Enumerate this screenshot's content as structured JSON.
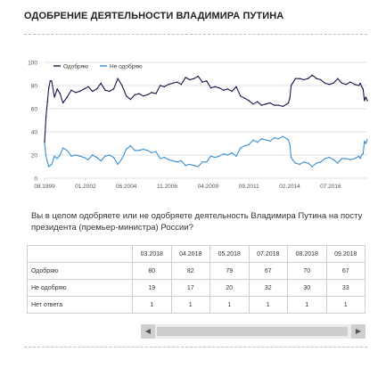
{
  "page": {
    "title": "ОДОБРЕНИЕ ДЕЯТЕЛЬНОСТИ ВЛАДИМИРА ПУТИНА",
    "question": "Вы в целом одобряете или не одобряете деятельность Владимира Путина на посту президента (премьер-министра) России?"
  },
  "colors": {
    "approve": "#1a1446",
    "disapprove": "#3a8fd0",
    "grid": "#d9d9d9",
    "axis_text": "#555555"
  },
  "chart_data": {
    "type": "line",
    "title": "",
    "xlabel": "",
    "ylabel": "",
    "ylim": [
      0,
      100
    ],
    "yticks": [
      "0",
      "20",
      "40",
      "60",
      "80",
      "100"
    ],
    "xlim": [
      "1999-08",
      "2018-09"
    ],
    "xticks": [
      {
        "date": "1999-08",
        "label": "08.1999"
      },
      {
        "date": "2002-01",
        "label": "01.2002"
      },
      {
        "date": "2004-06",
        "label": "06.2004"
      },
      {
        "date": "2006-11",
        "label": "11.2006"
      },
      {
        "date": "2009-04",
        "label": "04.2009"
      },
      {
        "date": "2011-09",
        "label": "09.2011"
      },
      {
        "date": "2014-02",
        "label": "02.2014"
      },
      {
        "date": "2016-07",
        "label": "07.2016"
      }
    ],
    "grid": true,
    "legend_position": "top-left",
    "series": [
      {
        "name": "Одобряю",
        "color_key": "approve",
        "points": [
          [
            "1999-08",
            31
          ],
          [
            "1999-09",
            53
          ],
          [
            "1999-10",
            66
          ],
          [
            "1999-11",
            78
          ],
          [
            "1999-12",
            84
          ],
          [
            "2000-01",
            84
          ],
          [
            "2000-03",
            70
          ],
          [
            "2000-05",
            77
          ],
          [
            "2000-07",
            73
          ],
          [
            "2000-09",
            65
          ],
          [
            "2000-12",
            70
          ],
          [
            "2001-03",
            76
          ],
          [
            "2001-06",
            74
          ],
          [
            "2001-09",
            75
          ],
          [
            "2001-12",
            77
          ],
          [
            "2002-03",
            79
          ],
          [
            "2002-06",
            75
          ],
          [
            "2002-09",
            77
          ],
          [
            "2002-12",
            82
          ],
          [
            "2003-03",
            76
          ],
          [
            "2003-06",
            75
          ],
          [
            "2003-09",
            77
          ],
          [
            "2003-12",
            86
          ],
          [
            "2004-03",
            80
          ],
          [
            "2004-06",
            71
          ],
          [
            "2004-09",
            68
          ],
          [
            "2004-12",
            72
          ],
          [
            "2005-03",
            73
          ],
          [
            "2005-06",
            71
          ],
          [
            "2005-09",
            72
          ],
          [
            "2005-12",
            74
          ],
          [
            "2006-03",
            73
          ],
          [
            "2006-06",
            80
          ],
          [
            "2006-09",
            79
          ],
          [
            "2006-12",
            81
          ],
          [
            "2007-03",
            82
          ],
          [
            "2007-06",
            83
          ],
          [
            "2007-09",
            81
          ],
          [
            "2007-12",
            87
          ],
          [
            "2008-03",
            85
          ],
          [
            "2008-06",
            86
          ],
          [
            "2008-09",
            88
          ],
          [
            "2008-12",
            83
          ],
          [
            "2009-03",
            84
          ],
          [
            "2009-06",
            78
          ],
          [
            "2009-09",
            79
          ],
          [
            "2009-12",
            78
          ],
          [
            "2010-03",
            76
          ],
          [
            "2010-06",
            77
          ],
          [
            "2010-09",
            75
          ],
          [
            "2010-12",
            79
          ],
          [
            "2011-03",
            71
          ],
          [
            "2011-06",
            69
          ],
          [
            "2011-09",
            67
          ],
          [
            "2011-12",
            64
          ],
          [
            "2012-03",
            66
          ],
          [
            "2012-06",
            63
          ],
          [
            "2012-09",
            64
          ],
          [
            "2012-12",
            65
          ],
          [
            "2013-03",
            63
          ],
          [
            "2013-06",
            63
          ],
          [
            "2013-09",
            62
          ],
          [
            "2013-12",
            64
          ],
          [
            "2014-01",
            65
          ],
          [
            "2014-02",
            69
          ],
          [
            "2014-03",
            80
          ],
          [
            "2014-04",
            82
          ],
          [
            "2014-06",
            86
          ],
          [
            "2014-09",
            86
          ],
          [
            "2014-12",
            85
          ],
          [
            "2015-03",
            86
          ],
          [
            "2015-06",
            89
          ],
          [
            "2015-09",
            86
          ],
          [
            "2015-12",
            85
          ],
          [
            "2016-03",
            82
          ],
          [
            "2016-06",
            81
          ],
          [
            "2016-09",
            82
          ],
          [
            "2016-12",
            86
          ],
          [
            "2017-03",
            82
          ],
          [
            "2017-06",
            81
          ],
          [
            "2017-09",
            83
          ],
          [
            "2017-12",
            81
          ],
          [
            "2018-03",
            80
          ],
          [
            "2018-04",
            82
          ],
          [
            "2018-05",
            79
          ],
          [
            "2018-06",
            77
          ],
          [
            "2018-07",
            67
          ],
          [
            "2018-08",
            70
          ],
          [
            "2018-09",
            67
          ]
        ]
      },
      {
        "name": "Не одобряю",
        "color_key": "disapprove",
        "points": [
          [
            "1999-08",
            30
          ],
          [
            "1999-09",
            19
          ],
          [
            "1999-10",
            14
          ],
          [
            "1999-11",
            10
          ],
          [
            "1999-12",
            11
          ],
          [
            "2000-01",
            12
          ],
          [
            "2000-03",
            19
          ],
          [
            "2000-05",
            17
          ],
          [
            "2000-07",
            20
          ],
          [
            "2000-09",
            26
          ],
          [
            "2000-12",
            24
          ],
          [
            "2001-03",
            19
          ],
          [
            "2001-06",
            20
          ],
          [
            "2001-09",
            19
          ],
          [
            "2001-12",
            18
          ],
          [
            "2002-03",
            16
          ],
          [
            "2002-06",
            20
          ],
          [
            "2002-09",
            18
          ],
          [
            "2002-12",
            15
          ],
          [
            "2003-03",
            19
          ],
          [
            "2003-06",
            20
          ],
          [
            "2003-09",
            18
          ],
          [
            "2003-12",
            12
          ],
          [
            "2004-03",
            17
          ],
          [
            "2004-06",
            25
          ],
          [
            "2004-09",
            28
          ],
          [
            "2004-12",
            24
          ],
          [
            "2005-03",
            24
          ],
          [
            "2005-06",
            25
          ],
          [
            "2005-09",
            24
          ],
          [
            "2005-12",
            22
          ],
          [
            "2006-03",
            23
          ],
          [
            "2006-06",
            17
          ],
          [
            "2006-09",
            18
          ],
          [
            "2006-12",
            16
          ],
          [
            "2007-03",
            15
          ],
          [
            "2007-06",
            14
          ],
          [
            "2007-09",
            15
          ],
          [
            "2007-12",
            11
          ],
          [
            "2008-03",
            12
          ],
          [
            "2008-06",
            11
          ],
          [
            "2008-09",
            10
          ],
          [
            "2008-12",
            14
          ],
          [
            "2009-03",
            14
          ],
          [
            "2009-06",
            19
          ],
          [
            "2009-09",
            18
          ],
          [
            "2009-12",
            19
          ],
          [
            "2010-03",
            21
          ],
          [
            "2010-06",
            20
          ],
          [
            "2010-09",
            22
          ],
          [
            "2010-12",
            19
          ],
          [
            "2011-03",
            26
          ],
          [
            "2011-06",
            28
          ],
          [
            "2011-09",
            29
          ],
          [
            "2011-12",
            33
          ],
          [
            "2012-03",
            31
          ],
          [
            "2012-06",
            34
          ],
          [
            "2012-09",
            33
          ],
          [
            "2012-12",
            32
          ],
          [
            "2013-03",
            35
          ],
          [
            "2013-06",
            34
          ],
          [
            "2013-09",
            36
          ],
          [
            "2013-12",
            34
          ],
          [
            "2014-01",
            33
          ],
          [
            "2014-02",
            29
          ],
          [
            "2014-03",
            18
          ],
          [
            "2014-04",
            16
          ],
          [
            "2014-06",
            13
          ],
          [
            "2014-09",
            12
          ],
          [
            "2014-12",
            14
          ],
          [
            "2015-03",
            13
          ],
          [
            "2015-06",
            10
          ],
          [
            "2015-09",
            13
          ],
          [
            "2015-12",
            14
          ],
          [
            "2016-03",
            17
          ],
          [
            "2016-06",
            18
          ],
          [
            "2016-09",
            16
          ],
          [
            "2016-12",
            13
          ],
          [
            "2017-03",
            17
          ],
          [
            "2017-06",
            17
          ],
          [
            "2017-09",
            16
          ],
          [
            "2017-12",
            17
          ],
          [
            "2018-03",
            19
          ],
          [
            "2018-04",
            17
          ],
          [
            "2018-05",
            20
          ],
          [
            "2018-06",
            21
          ],
          [
            "2018-07",
            32
          ],
          [
            "2018-08",
            30
          ],
          [
            "2018-09",
            33
          ]
        ]
      }
    ]
  },
  "table": {
    "columns": [
      "03.2018",
      "04.2018",
      "05.2018",
      "07.2018",
      "08.2018",
      "09.2018"
    ],
    "rows": [
      {
        "label": "Одобряю",
        "values": [
          "80",
          "82",
          "79",
          "67",
          "70",
          "67"
        ]
      },
      {
        "label": "Не одобряю",
        "values": [
          "19",
          "17",
          "20",
          "32",
          "30",
          "33"
        ]
      },
      {
        "label": "Нет ответа",
        "values": [
          "1",
          "1",
          "1",
          "1",
          "1",
          "1"
        ]
      }
    ]
  },
  "scrollbar": {
    "left_icon": "triangle-left-icon",
    "right_icon": "triangle-right-icon",
    "left_glyph": "◀",
    "right_glyph": "▶"
  }
}
